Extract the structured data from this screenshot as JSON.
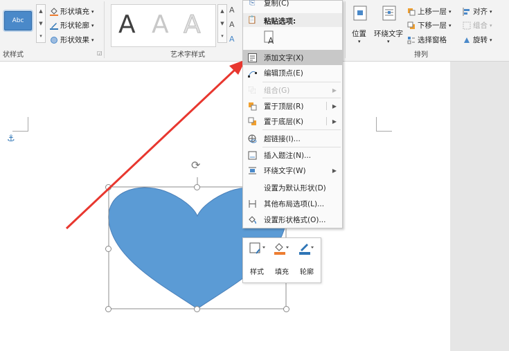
{
  "colors": {
    "accent": "#4a89c9",
    "heart": "#5b9bd5",
    "arrow": "#e8372f",
    "fill_orange": "#ed7d31",
    "outline_blue": "#2e75b6"
  },
  "ribbon": {
    "shape_styles": {
      "group_label": "状样式",
      "style_swatch": "Abc",
      "fill_label": "形状填充",
      "outline_label": "形状轮廓",
      "effects_label": "形状效果"
    },
    "wordart": {
      "group_label": "艺术字样式",
      "sample": "A",
      "text_btn_char": "A"
    },
    "arrange": {
      "group_label": "排列",
      "position_label": "位置",
      "wrap_label": "环绕文字",
      "bring_forward": "上移一层",
      "send_backward": "下移一层",
      "selection_pane": "选择窗格",
      "align": "对齐",
      "group": "组合",
      "rotate": "旋转"
    }
  },
  "context_menu": {
    "copy": "复制(C)",
    "paste_options": "粘贴选项:",
    "items": [
      {
        "label": "添加文字(X)",
        "icon": "add-text-icon",
        "disabled": false,
        "submenu": false,
        "highlighted": true
      },
      {
        "label": "编辑顶点(E)",
        "icon": "edit-points-icon",
        "disabled": false,
        "submenu": false
      },
      {
        "label": "组合(G)",
        "icon": "group-icon",
        "disabled": true,
        "submenu": true
      },
      {
        "label": "置于顶层(R)",
        "icon": "bring-to-front-icon",
        "disabled": false,
        "submenu": true
      },
      {
        "label": "置于底层(K)",
        "icon": "send-to-back-icon",
        "disabled": false,
        "submenu": true
      },
      {
        "label": "超链接(I)...",
        "icon": "hyperlink-icon",
        "disabled": false,
        "submenu": false
      },
      {
        "label": "插入题注(N)...",
        "icon": "insert-caption-icon",
        "disabled": false,
        "submenu": false
      },
      {
        "label": "环绕文字(W)",
        "icon": "wrap-text-icon",
        "disabled": false,
        "submenu": true
      },
      {
        "label": "设置为默认形状(D)",
        "icon": "",
        "disabled": false,
        "submenu": false
      },
      {
        "label": "其他布局选项(L)...",
        "icon": "layout-options-icon",
        "disabled": false,
        "submenu": false
      },
      {
        "label": "设置形状格式(O)...",
        "icon": "format-shape-icon",
        "disabled": false,
        "submenu": false
      }
    ]
  },
  "mini_toolbar": {
    "style_label": "样式",
    "fill_label": "填充",
    "outline_label": "轮廓"
  }
}
